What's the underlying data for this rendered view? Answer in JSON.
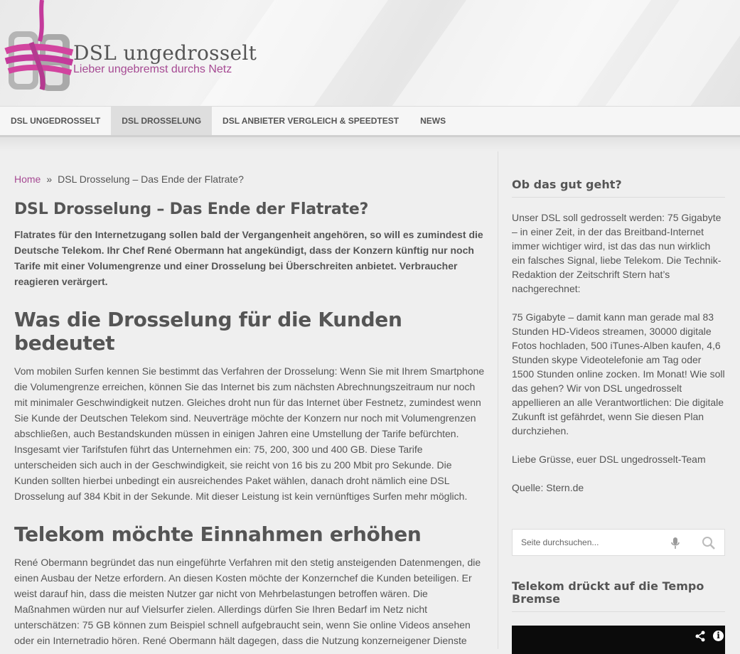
{
  "site": {
    "title": "DSL ungedrosselt",
    "tagline": "Lieber ungebremst durchs Netz",
    "logo_mark_icon": "rope-tied-logo-icon"
  },
  "nav": {
    "items": [
      {
        "label": "DSL UNGEDROSSELT"
      },
      {
        "label": "DSL DROSSELUNG",
        "active": true
      },
      {
        "label": "DSL ANBIETER VERGLEICH & SPEEDTEST"
      },
      {
        "label": "NEWS"
      }
    ]
  },
  "breadcrumb": {
    "home": "Home",
    "separator": "»",
    "current": "DSL Drosselung – Das Ende der Flatrate?"
  },
  "article": {
    "title": "DSL Drosselung – Das Ende der Flatrate?",
    "intro": "Flatrates für den Internetzugang sollen bald der Vergangenheit angehören, so will es zumindest die Deutsche Telekom. Ihr Chef René Obermann hat angekündigt, dass der Konzern künftig nur noch Tarife mit einer Volumengrenze und einer Drosselung bei Überschreiten anbietet. Verbraucher reagieren verärgert.",
    "section1_heading": "Was die Drosselung für die Kunden bedeutet",
    "section1_text": "Vom mobilen Surfen kennen Sie bestimmt das Verfahren der Drosselung: Wenn Sie mit Ihrem Smartphone die Volumengrenze erreichen, können Sie das Internet bis zum nächsten Abrechnungszeitraum nur noch mit minimaler Geschwindigkeit nutzen. Gleiches droht nun für das Internet über Festnetz, zumindest wenn Sie Kunde der Deutschen Telekom sind. Neuverträge möchte der Konzern nur noch mit Volumengrenzen abschließen, auch Bestandskunden müssen in einigen Jahren eine Umstellung der Tarife befürchten. Insgesamt vier Tarifstufen führt das Unternehmen ein: 75, 200, 300 und 400 GB. Diese Tarife unterscheiden sich auch in der Geschwindigkeit, sie reicht von 16 bis zu 200 Mbit pro Sekunde. Die Kunden sollten hierbei unbedingt ein ausreichendes Paket wählen, danach droht nämlich eine DSL Drosselung auf 384 Kbit in der Sekunde. Mit dieser Leistung ist kein vernünftiges Surfen mehr möglich.",
    "section2_heading": "Telekom möchte Einnahmen erhöhen",
    "section2_text": "René Obermann begründet das nun eingeführte Verfahren mit den stetig ansteigenden Datenmengen, die einen Ausbau der Netze erfordern. An diesen Kosten möchte der Konzernchef die Kunden beteiligen. Er weist darauf hin, dass die meisten Nutzer gar nicht von Mehrbelastungen betroffen wären. Die Maßnahmen würden nur auf Vielsurfer zielen. Allerdings dürfen Sie Ihren Bedarf im Netz nicht unterschätzen: 75 GB können zum Beispiel schnell aufgebraucht sein, wenn Sie online Videos ansehen oder ein Internetradio hören. René Obermann hält dagegen, dass die Nutzung konzerneigener Dienste"
  },
  "sidebar": {
    "widget1_title": "Ob das gut geht?",
    "widget1_p1": "Unser DSL soll gedrosselt werden: 75 Gigabyte – in einer Zeit, in der das Breitband-Internet immer wichtiger wird, ist das das nun wirklich ein falsches Signal, liebe Telekom. Die Technik-Redaktion der Zeitschrift Stern hat’s nachgerechnet:",
    "widget1_p2": "75 Gigabyte – damit kann man gerade mal 83 Stunden HD-Videos streamen, 30000 digitale Fotos hochladen, 500 iTunes-Alben kaufen, 4,6 Stunden skype Videotelefonie am Tag oder 1500 Stunden online zocken. Im Monat! Wie soll das gehen? Wir von DSL ungedrosselt appellieren an alle Verantwortlichen: Die digitale Zukunft ist gefährdet, wenn Sie diesen Plan durchziehen.",
    "widget1_p3": "Liebe Grüsse, euer DSL ungedrosselt-Team",
    "widget1_p4": "Quelle: Stern.de",
    "search_placeholder": "Seite durchsuchen...",
    "widget2_title": "Telekom drückt auf die Tempo Bremse",
    "info_glyph": "i"
  },
  "colors": {
    "accent": "#a64a93",
    "background": "#efefef",
    "text": "#555555"
  }
}
